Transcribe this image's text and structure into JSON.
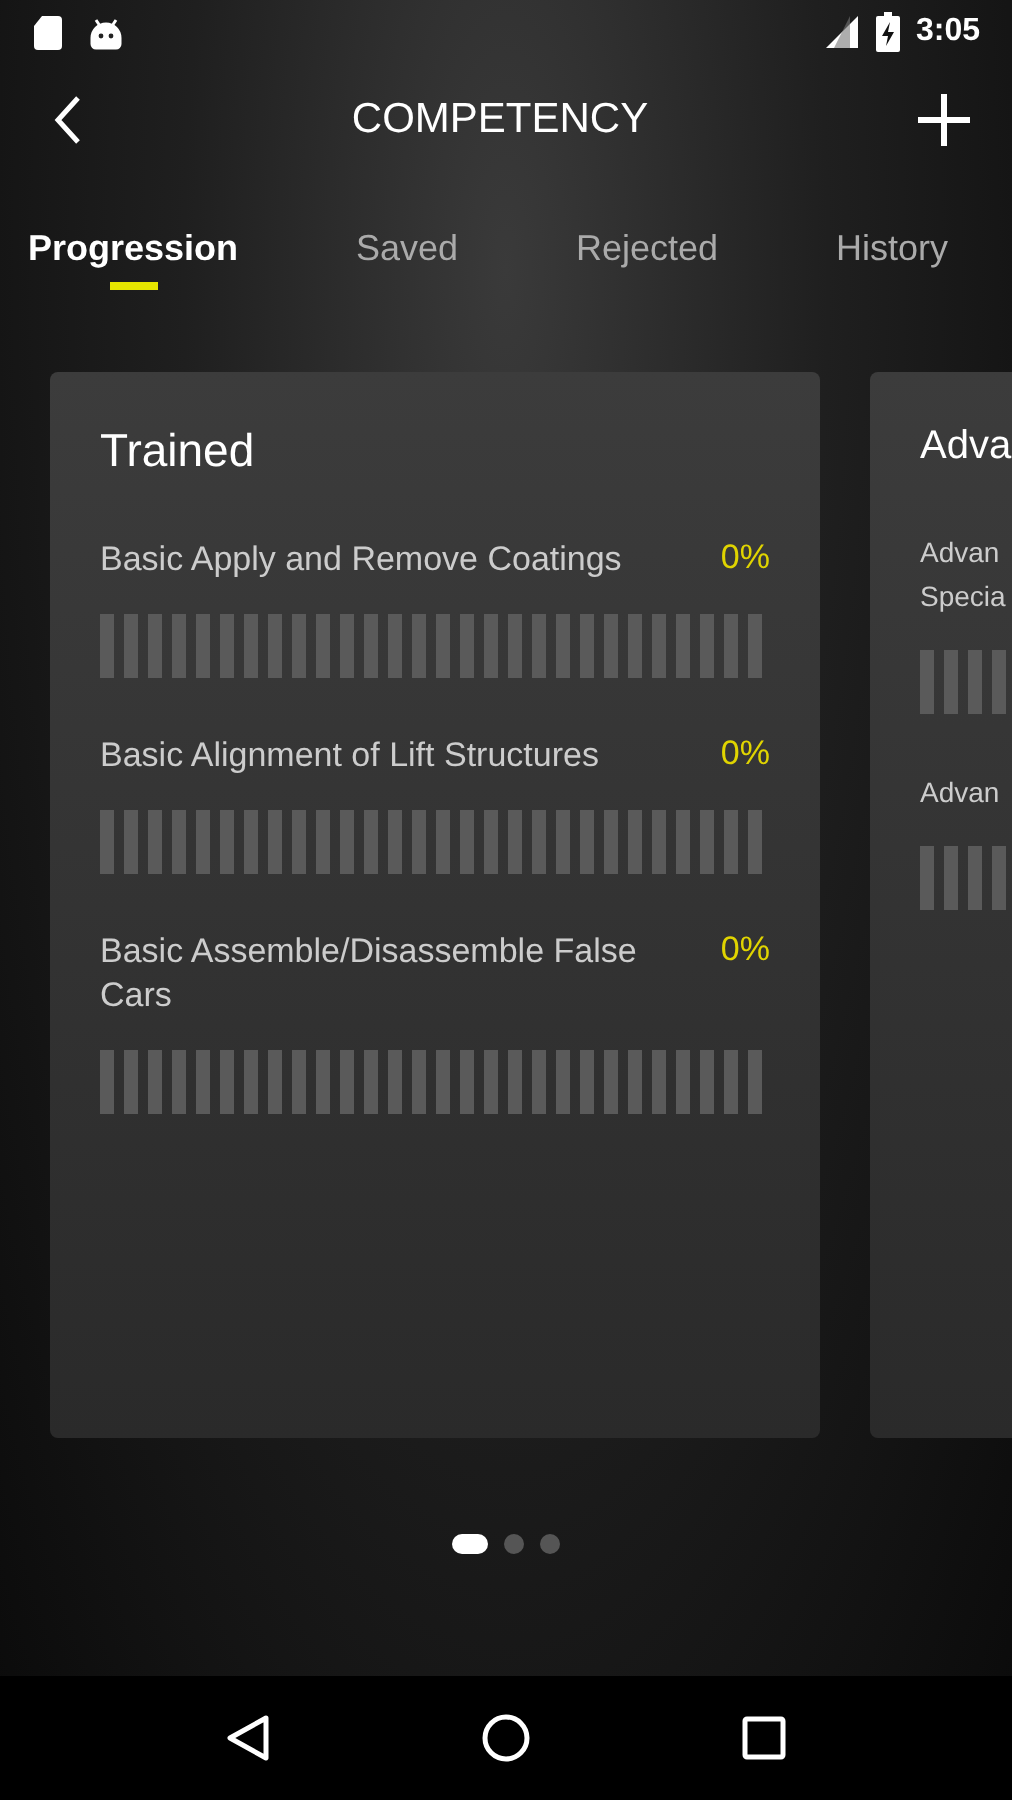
{
  "status_bar": {
    "time": "3:05"
  },
  "header": {
    "title": "COMPETENCY"
  },
  "tabs": [
    {
      "label": "Progression",
      "selected": true
    },
    {
      "label": "Saved",
      "selected": false
    },
    {
      "label": "Rejected",
      "selected": false
    },
    {
      "label": "History",
      "selected": false
    }
  ],
  "cards": [
    {
      "title": "Trained",
      "items": [
        {
          "name": "Basic Apply and Remove Coatings",
          "percent": "0%",
          "level": 0
        },
        {
          "name": "Basic Alignment of Lift Structures",
          "percent": "0%",
          "level": 0
        },
        {
          "name": "Basic Assemble/Disassemble False Cars",
          "percent": "0%",
          "level": 0
        }
      ]
    },
    {
      "title": "Adva",
      "items": [
        {
          "name": "Advan\nSpecia",
          "level": 0
        },
        {
          "name": "Advan",
          "level": 0
        }
      ]
    }
  ],
  "pages": [
    {
      "selected": true
    },
    {
      "selected": false
    },
    {
      "selected": false
    }
  ]
}
